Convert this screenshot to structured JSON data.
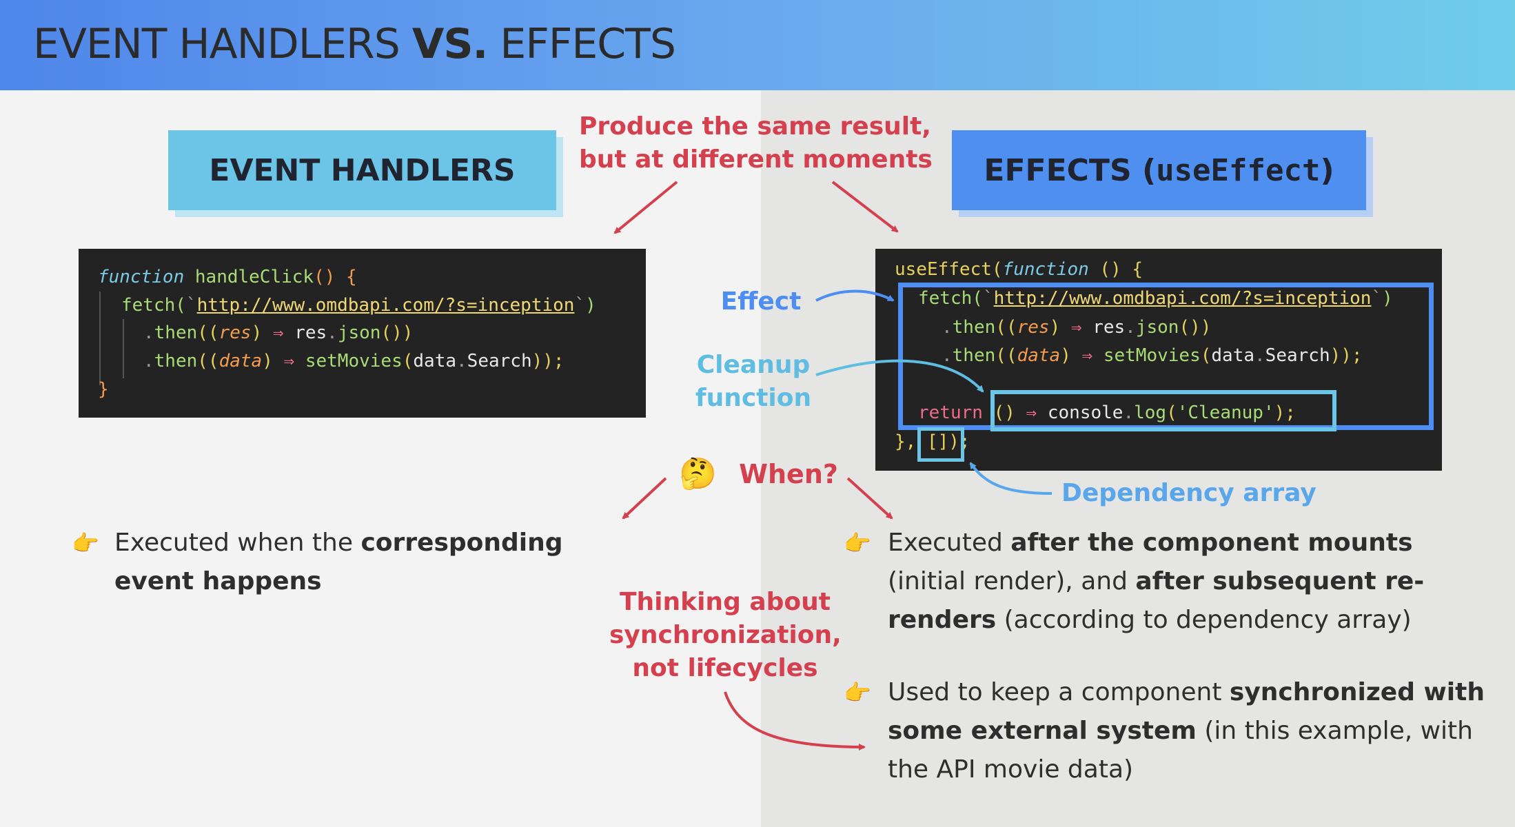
{
  "title": {
    "plain_1": "EVENT HANDLERS ",
    "bold": "VS.",
    "plain_2": " EFFECTS"
  },
  "labels": {
    "left": "EVENT HANDLERS",
    "right_prefix": "EFFECTS (",
    "right_code": "useEffect",
    "right_suffix": ")"
  },
  "annotations": {
    "same_result_line1": "Produce the same result,",
    "same_result_line2_plain": "but at ",
    "same_result_line2_bold": "different moments",
    "effect": "Effect",
    "cleanup_line1": "Cleanup",
    "cleanup_line2": "function",
    "dependency": "Dependency array",
    "when_emoji": "🤔",
    "when": "When?",
    "sync_line1": "Thinking about",
    "sync_line2": "synchronization,",
    "sync_line3_bold": "not",
    "sync_line3_plain": " lifecycles"
  },
  "code_left": {
    "l1_kw": "function",
    "l1_name": " handleClick",
    "l1_paren": "()",
    "l1_brace": " {",
    "l2_fetch": "fetch(",
    "l2_tick_open": "`",
    "l2_url": "http://www.omdbapi.com/?s=inception",
    "l2_tick_close": "`",
    "l2_close": ")",
    "l3_dot": ".",
    "l3_then": "then",
    "l3_open": "((",
    "l3_param": "res",
    "l3_close_paren": ")",
    "l3_arrow": " ⇒ ",
    "l3_res": "res",
    "l3_dot2": ".",
    "l3_json": "json",
    "l3_end": "())",
    "l4_dot": ".",
    "l4_then": "then",
    "l4_open": "((",
    "l4_param": "data",
    "l4_close_paren": ")",
    "l4_arrow": " ⇒ ",
    "l4_set": "setMovies",
    "l4_po": "(",
    "l4_data": "data",
    "l4_dot2": ".",
    "l4_search": "Search",
    "l4_end": "));",
    "l5_brace": "}"
  },
  "code_right": {
    "l1_use": "useEffect(",
    "l1_kw": "function",
    "l1_rest": " () {",
    "l2_fetch": "fetch(",
    "l2_tick_open": "`",
    "l2_url": "http://www.omdbapi.com/?s=inception",
    "l2_tick_close": "`",
    "l2_close": ")",
    "l3_dot": ".",
    "l3_then": "then",
    "l3_open": "((",
    "l3_param": "res",
    "l3_close_paren": ")",
    "l3_arrow": " ⇒ ",
    "l3_res": "res",
    "l3_dot2": ".",
    "l3_json": "json",
    "l3_end": "())",
    "l4_dot": ".",
    "l4_then": "then",
    "l4_open": "((",
    "l4_param": "data",
    "l4_close_paren": ")",
    "l4_arrow": " ⇒ ",
    "l4_set": "setMovies",
    "l4_po": "(",
    "l4_data": "data",
    "l4_dot2": ".",
    "l4_search": "Search",
    "l4_end": "));",
    "l5_return": "return",
    "l5_parens": " () ",
    "l5_arrow": "⇒",
    "l5_console": " console",
    "l5_dot": ".",
    "l5_log": "log",
    "l5_po": "(",
    "l5_str": "'Cleanup'",
    "l5_end": ");",
    "l6_brace": "},",
    "l6_deps": " []",
    "l6_end": ");"
  },
  "bullets": {
    "hand_icon": "👉",
    "left_1_plain": "Executed when the ",
    "left_1_bold": "corresponding event happens",
    "right_1_plain1": "Executed ",
    "right_1_bold1": "after the component mounts",
    "right_1_plain2": " (initial render), and ",
    "right_1_bold2": "after subsequent re-renders",
    "right_1_plain3": " (according to dependency array)",
    "right_2_plain1": "Used to keep a component ",
    "right_2_bold": "synchronized with some external system",
    "right_2_plain2": " (in this example, with the API movie data)"
  },
  "colors": {
    "header_start": "#4f86ea",
    "header_end": "#6fcdea",
    "accent_red": "#d5404f",
    "accent_blue": "#4e8ef2",
    "accent_cyan": "#5fbde2",
    "code_bg": "#232323"
  }
}
